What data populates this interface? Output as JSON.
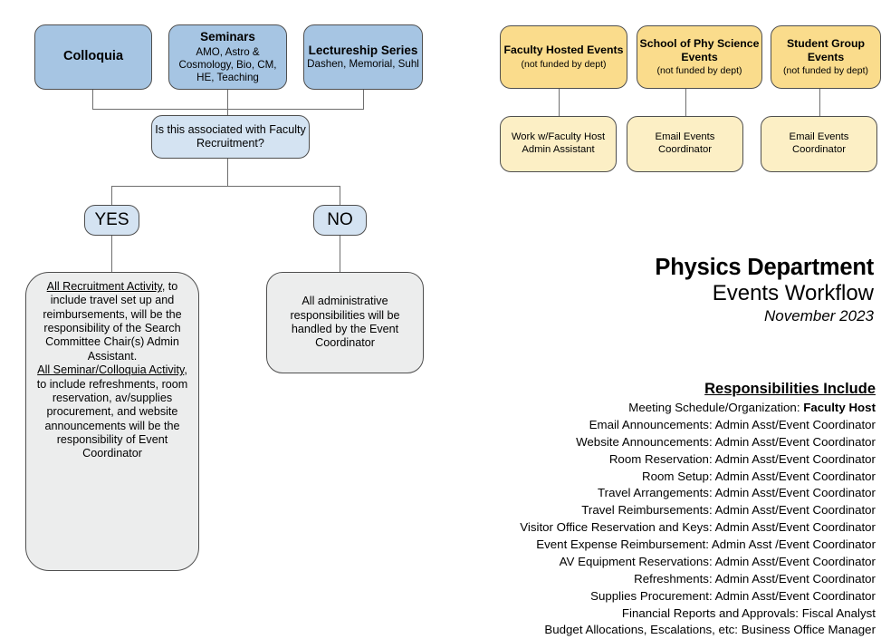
{
  "colors": {
    "blue": "#a6c5e3",
    "blue_light": "#d4e3f2",
    "gray": "#eceded",
    "yellow": "#fadc8c",
    "yellow_light": "#fcefc5",
    "line": "#6e6e6e"
  },
  "flow": {
    "sources": [
      {
        "title": "Colloquia",
        "subtitle": ""
      },
      {
        "title": "Seminars",
        "subtitle": "AMO, Astro & Cosmology, Bio, CM, HE, Teaching"
      },
      {
        "title": "Lectureship Series",
        "subtitle": "Dashen, Memorial, Suhl"
      }
    ],
    "decision": "Is this associated with Faculty Recruitment?",
    "yes_label": "YES",
    "no_label": "NO",
    "yes_detail": {
      "lead1": "All Recruitment Activity",
      "body1": ", to include travel set up and reimbursements, will be the responsibility of the Search Committee Chair(s) Admin Assistant.",
      "lead2": "All Seminar/Colloquia Activity",
      "body2": ", to include refreshments, room reservation, av/supplies procurement, and website announcements will be the responsibility of Event Coordinator"
    },
    "no_detail": "All administrative responsibilities will be handled by the Event Coordinator"
  },
  "external": {
    "items": [
      {
        "title": "Faculty Hosted Events",
        "note": "(not funded by dept)",
        "action": "Work w/Faculty Host Admin Assistant"
      },
      {
        "title": "School of Phy Science Events",
        "note": "(not funded by dept)",
        "action": "Email Events Coordinator"
      },
      {
        "title": "Student Group Events",
        "note": "(not funded by dept)",
        "action": "Email Events Coordinator"
      }
    ]
  },
  "title": {
    "line1": "Physics Department",
    "line2": "Events Workflow",
    "line3": "November 2023"
  },
  "responsibilities": {
    "heading": "Responsibilities Include",
    "rows": [
      {
        "task": "Meeting Schedule/Organization: ",
        "owner": "Faculty Host",
        "bold_owner": true
      },
      {
        "task": "Email Announcements: ",
        "owner": "Admin Asst/Event Coordinator",
        "bold_owner": false
      },
      {
        "task": "Website Announcements: ",
        "owner": "Admin Asst/Event Coordinator",
        "bold_owner": false
      },
      {
        "task": "Room Reservation: ",
        "owner": "Admin Asst/Event Coordinator",
        "bold_owner": false
      },
      {
        "task": "Room Setup: ",
        "owner": "Admin Asst/Event Coordinator",
        "bold_owner": false
      },
      {
        "task": "Travel Arrangements: ",
        "owner": "Admin Asst/Event Coordinator",
        "bold_owner": false
      },
      {
        "task": "Travel Reimbursements: ",
        "owner": "Admin Asst/Event Coordinator",
        "bold_owner": false
      },
      {
        "task": "Visitor Office Reservation and Keys: ",
        "owner": "Admin Asst/Event Coordinator",
        "bold_owner": false
      },
      {
        "task": "Event Expense Reimbursement: ",
        "owner": "Admin Asst /Event Coordinator",
        "bold_owner": false
      },
      {
        "task": "AV Equipment Reservations: ",
        "owner": "Admin Asst/Event Coordinator",
        "bold_owner": false
      },
      {
        "task": "Refreshments: ",
        "owner": "Admin Asst/Event Coordinator",
        "bold_owner": false
      },
      {
        "task": "Supplies Procurement: ",
        "owner": "Admin Asst/Event Coordinator",
        "bold_owner": false
      },
      {
        "task": "Financial Reports and Approvals: ",
        "owner": "Fiscal Analyst",
        "bold_owner": false
      },
      {
        "task": "Budget Allocations, Escalations, etc: ",
        "owner": "Business Office Manager",
        "bold_owner": false
      }
    ]
  }
}
